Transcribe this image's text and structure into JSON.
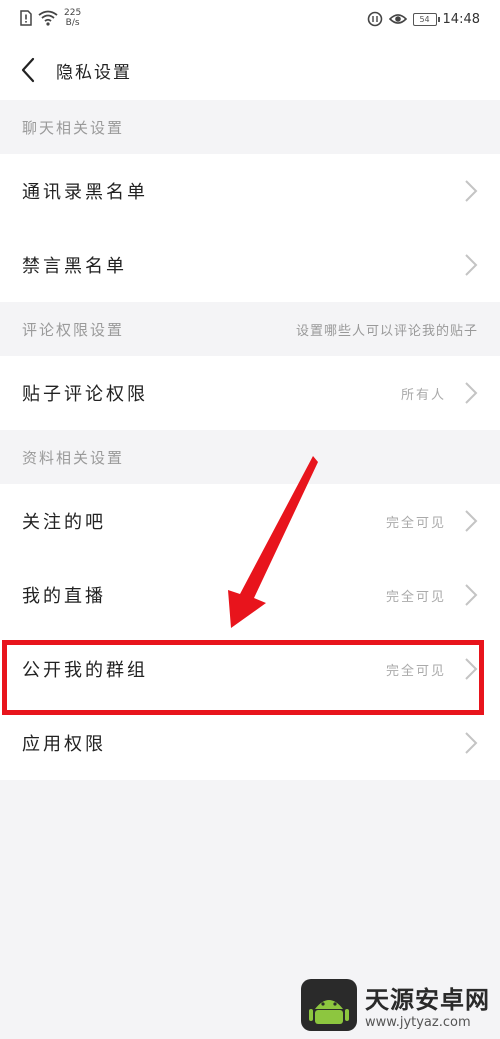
{
  "status_bar": {
    "speed_value": "225",
    "speed_unit": "B/s",
    "battery": "54",
    "time": "14:48"
  },
  "header": {
    "title": "隐私设置"
  },
  "sections": [
    {
      "title": "聊天相关设置",
      "note": "",
      "items": [
        {
          "label": "通讯录黑名单",
          "value": ""
        },
        {
          "label": "禁言黑名单",
          "value": ""
        }
      ]
    },
    {
      "title": "评论权限设置",
      "note": "设置哪些人可以评论我的贴子",
      "items": [
        {
          "label": "贴子评论权限",
          "value": "所有人"
        }
      ]
    },
    {
      "title": "资料相关设置",
      "note": "",
      "items": [
        {
          "label": "关注的吧",
          "value": "完全可见"
        },
        {
          "label": "我的直播",
          "value": "完全可见"
        },
        {
          "label": "公开我的群组",
          "value": "完全可见"
        },
        {
          "label": "应用权限",
          "value": ""
        }
      ]
    }
  ],
  "annotation": {
    "color": "#e8141c"
  },
  "watermark": {
    "name": "天源安卓网",
    "url": "www.jytyaz.com"
  }
}
